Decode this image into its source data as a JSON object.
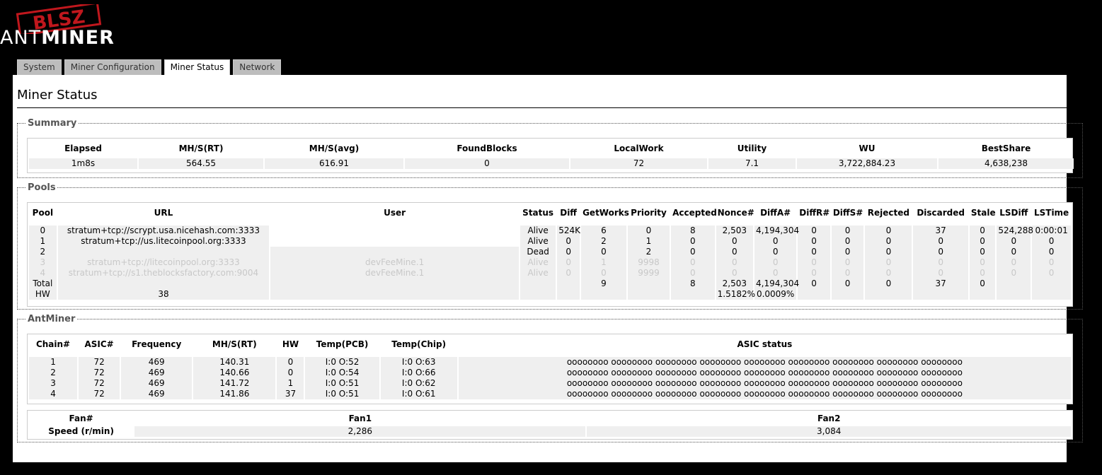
{
  "brand": {
    "stamp_text": "BLSZ",
    "logo_left": "ANT",
    "logo_right": "MINER"
  },
  "tabs": [
    {
      "label": "System",
      "active": false
    },
    {
      "label": "Miner Configuration",
      "active": false
    },
    {
      "label": "Miner Status",
      "active": true
    },
    {
      "label": "Network",
      "active": false
    }
  ],
  "page_title": "Miner Status",
  "summary": {
    "legend": "Summary",
    "headers": [
      "Elapsed",
      "MH/S(RT)",
      "MH/S(avg)",
      "FoundBlocks",
      "LocalWork",
      "Utility",
      "WU",
      "BestShare"
    ],
    "values": [
      "1m8s",
      "564.55",
      "616.91",
      "0",
      "72",
      "7.1",
      "3,722,884.23",
      "4,638,238"
    ]
  },
  "pools": {
    "legend": "Pools",
    "headers": [
      "Pool",
      "URL",
      "User",
      "Status",
      "Diff",
      "GetWorks",
      "Priority",
      "Accepted",
      "Nonce#",
      "DiffA#",
      "DiffR#",
      "DiffS#",
      "Rejected",
      "Discarded",
      "Stale",
      "LSDiff",
      "LSTime"
    ],
    "rows": [
      [
        "0",
        "stratum+tcp://scrypt.usa.nicehash.com:3333",
        "",
        "Alive",
        "524K",
        "6",
        "0",
        "8",
        "2,503",
        "4,194,304",
        "0",
        "0",
        "0",
        "37",
        "0",
        "524,288",
        "0:00:01"
      ],
      [
        "1",
        "stratum+tcp://us.litecoinpool.org:3333",
        "",
        "Alive",
        "0",
        "2",
        "1",
        "0",
        "0",
        "0",
        "0",
        "0",
        "0",
        "0",
        "0",
        "0",
        "0"
      ],
      [
        "2",
        "",
        "",
        "Dead",
        "0",
        "0",
        "2",
        "0",
        "0",
        "0",
        "0",
        "0",
        "0",
        "0",
        "0",
        "0",
        "0"
      ],
      [
        "3",
        "stratum+tcp://litecoinpool.org:3333",
        "devFeeMine.1",
        "Alive",
        "0",
        "1",
        "9998",
        "0",
        "0",
        "0",
        "0",
        "0",
        "0",
        "0",
        "0",
        "0",
        "0"
      ],
      [
        "4",
        "stratum+tcp://s1.theblocksfactory.com:9004",
        "devFeeMine.1",
        "Alive",
        "0",
        "0",
        "9999",
        "0",
        "0",
        "0",
        "0",
        "0",
        "0",
        "0",
        "0",
        "0",
        "0"
      ],
      [
        "Total",
        "",
        "",
        "",
        "",
        "9",
        "",
        "8",
        "2,503",
        "4,194,304",
        "0",
        "0",
        "0",
        "37",
        "0",
        "",
        ""
      ],
      [
        "HW",
        "38",
        "",
        "",
        "",
        "",
        "",
        "",
        "1.5182%",
        "0.0009%",
        "",
        "",
        "",
        "",
        "",
        "",
        ""
      ]
    ]
  },
  "antminer": {
    "legend": "AntMiner",
    "headers": [
      "Chain#",
      "ASIC#",
      "Frequency",
      "MH/S(RT)",
      "HW",
      "Temp(PCB)",
      "Temp(Chip)",
      "ASIC status"
    ],
    "rows": [
      [
        "1",
        "72",
        "469",
        "140.31",
        "0",
        "I:0 O:52",
        "I:0 O:63",
        "oooooooo oooooooo oooooooo oooooooo oooooooo oooooooo oooooooo oooooooo oooooooo"
      ],
      [
        "2",
        "72",
        "469",
        "140.66",
        "0",
        "I:0 O:54",
        "I:0 O:66",
        "oooooooo oooooooo oooooooo oooooooo oooooooo oooooooo oooooooo oooooooo oooooooo"
      ],
      [
        "3",
        "72",
        "469",
        "141.72",
        "1",
        "I:0 O:51",
        "I:0 O:62",
        "oooooooo oooooooo oooooooo oooooooo oooooooo oooooooo oooooooo oooooooo oooooooo"
      ],
      [
        "4",
        "72",
        "469",
        "141.86",
        "37",
        "I:0 O:51",
        "I:0 O:61",
        "oooooooo oooooooo oooooooo oooooooo oooooooo oooooooo oooooooo oooooooo oooooooo"
      ]
    ],
    "fans": {
      "headers": [
        "Fan#",
        "Fan1",
        "Fan2"
      ],
      "label": "Speed (r/min)",
      "values": [
        "2,286",
        "3,084"
      ]
    }
  }
}
